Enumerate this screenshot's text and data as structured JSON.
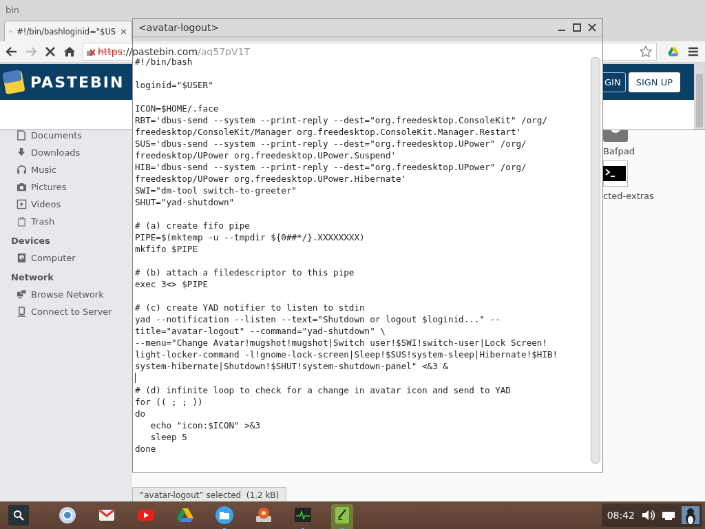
{
  "browser": {
    "window_title": "bin",
    "tab": {
      "title": "#!/bin/bashloginid=\"$US",
      "close": "×"
    },
    "address": {
      "scheme": "https",
      "host": "://pastebin.com",
      "path": "/aq57pV1T"
    },
    "site": {
      "logo": "PASTEBIN",
      "buttons": [
        {
          "label": "GIN",
          "kind": "outline"
        },
        {
          "label": "SIGN UP",
          "kind": "solid"
        }
      ]
    }
  },
  "file_manager": {
    "places": [
      "Documents",
      "Downloads",
      "Music",
      "Pictures",
      "Videos",
      "Trash"
    ],
    "sections": [
      {
        "heading": "Devices",
        "items": [
          "Computer"
        ]
      },
      {
        "heading": "Network",
        "items": [
          "Browse Network",
          "Connect to Server"
        ]
      }
    ],
    "files": [
      {
        "name": "Bafpad"
      },
      {
        "name": "cted-extras"
      }
    ],
    "status": "“avatar-logout” selected  (1.2 kB)"
  },
  "editor": {
    "title": "<avatar-logout>",
    "blocks": [
      {
        "lines": [
          "#!/bin/bash"
        ],
        "caret": false
      },
      {
        "lines": [
          "loginid=\"$USER\""
        ],
        "caret": false
      },
      {
        "lines": [
          "ICON=$HOME/.face",
          "RBT='dbus-send --system --print-reply --dest=\"org.freedesktop.ConsoleKit\" /org/",
          "freedesktop/ConsoleKit/Manager org.freedesktop.ConsoleKit.Manager.Restart'",
          "SUS='dbus-send --system --print-reply --dest=\"org.freedesktop.UPower\" /org/",
          "freedesktop/UPower org.freedesktop.UPower.Suspend'",
          "HIB='dbus-send --system --print-reply --dest=\"org.freedesktop.UPower\" /org/",
          "freedesktop/UPower org.freedesktop.UPower.Hibernate'",
          "SWI=\"dm-tool switch-to-greeter\"",
          "SHUT=\"yad-shutdown\""
        ],
        "caret": false
      },
      {
        "lines": [
          "# (a) create fifo pipe",
          "PIPE=$(mktemp -u --tmpdir ${0##*/}.XXXXXXXX)",
          "mkfifo $PIPE"
        ],
        "caret": false
      },
      {
        "lines": [
          "# (b) attach a filedescriptor to this pipe",
          "exec 3<> $PIPE"
        ],
        "caret": false
      },
      {
        "lines": [
          "# (c) create YAD notifier to listen to stdin",
          "yad --notification --listen --text=\"Shutdown or logout $loginid...\" --",
          "title=\"avatar-logout\" --command=\"yad-shutdown\" \\",
          "--menu=\"Change Avatar!mugshot!mugshot|Switch user!$SWI!switch-user|Lock Screen!",
          "light-locker-command -l!gnome-lock-screen|Sleep!$SUS!system-sleep|Hibernate!$HIB!",
          "system-hibernate|Shutdown!$SHUT!system-shutdown-panel\" <&3 &"
        ],
        "caret": true
      },
      {
        "lines": [
          "# (d) infinite loop to check for a change in avatar icon and send to YAD",
          "for (( ; ; ))",
          "do",
          "   echo \"icon:$ICON\" >&3",
          "   sleep 5",
          "done"
        ],
        "caret": false
      }
    ]
  },
  "taskbar": {
    "apps": [
      {
        "running": false,
        "active": false
      },
      {
        "running": false,
        "active": false
      },
      {
        "running": false,
        "active": false
      },
      {
        "running": false,
        "active": false
      },
      {
        "running": true,
        "active": false
      },
      {
        "running": false,
        "active": false
      },
      {
        "running": true,
        "active": false
      },
      {
        "running": true,
        "active": true
      }
    ],
    "clock": "08:42"
  }
}
